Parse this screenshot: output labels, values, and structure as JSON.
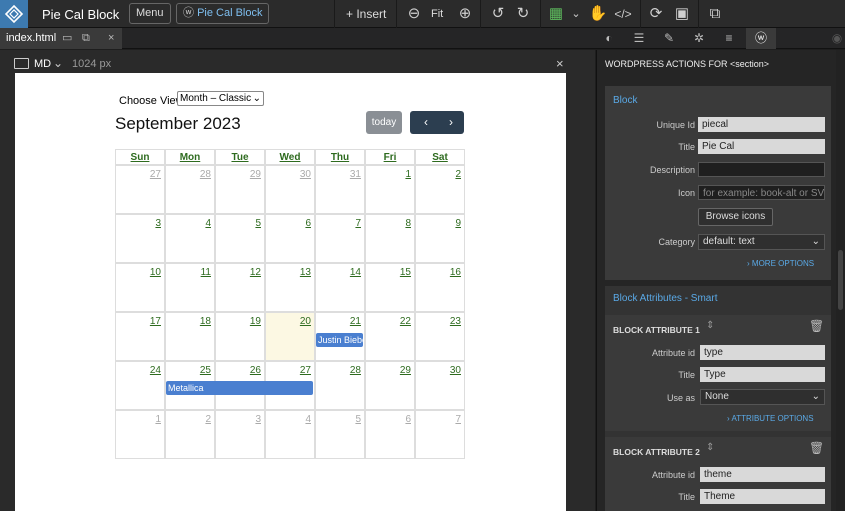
{
  "app": {
    "title": "Pie Cal Block",
    "menu_label": "Menu",
    "wp_label": "Pie Cal Block",
    "insert_label": "+ Insert",
    "fit_label": "Fit"
  },
  "tabs": {
    "file": "index.html"
  },
  "canvas": {
    "breakpoint": "MD",
    "width_label": "1024 px"
  },
  "calendar": {
    "choose_view_label": "Choose View",
    "view_value": "Month – Classic",
    "month_title": "September 2023",
    "today_label": "today",
    "prev_glyph": "‹",
    "next_glyph": "›",
    "days_of_week": [
      "Sun",
      "Mon",
      "Tue",
      "Wed",
      "Thu",
      "Fri",
      "Sat"
    ],
    "weeks": [
      [
        "27",
        "28",
        "29",
        "30",
        "31",
        "1",
        "2"
      ],
      [
        "3",
        "4",
        "5",
        "6",
        "7",
        "8",
        "9"
      ],
      [
        "10",
        "11",
        "12",
        "13",
        "14",
        "15",
        "16"
      ],
      [
        "17",
        "18",
        "19",
        "20",
        "21",
        "22",
        "23"
      ],
      [
        "24",
        "25",
        "26",
        "27",
        "28",
        "29",
        "30"
      ],
      [
        "1",
        "2",
        "3",
        "4",
        "5",
        "6",
        "7"
      ]
    ],
    "events": {
      "justin": "Justin Biebe",
      "metallica": "Metallica"
    }
  },
  "panel": {
    "header": "WORDPRESS ACTIONS FOR  <section>",
    "block": {
      "title": "Block",
      "unique_id_label": "Unique Id",
      "unique_id_value": "piecal",
      "title_label": "Title",
      "title_value": "Pie Cal",
      "description_label": "Description",
      "icon_label": "Icon",
      "icon_placeholder": "for example: book-alt or SV",
      "browse_label": "Browse icons",
      "category_label": "Category",
      "category_value": "default: text",
      "more_options": "MORE OPTIONS"
    },
    "attributes": {
      "title": "Block Attributes - Smart",
      "attr1": {
        "heading": "BLOCK ATTRIBUTE 1",
        "id_label": "Attribute id",
        "id_value": "type",
        "title_label": "Title",
        "title_value": "Type",
        "use_as_label": "Use as",
        "use_as_value": "None",
        "options": "ATTRIBUTE OPTIONS"
      },
      "attr2": {
        "heading": "BLOCK ATTRIBUTE 2",
        "id_label": "Attribute id",
        "id_value": "theme",
        "title_label": "Title",
        "title_value": "Theme"
      }
    }
  }
}
